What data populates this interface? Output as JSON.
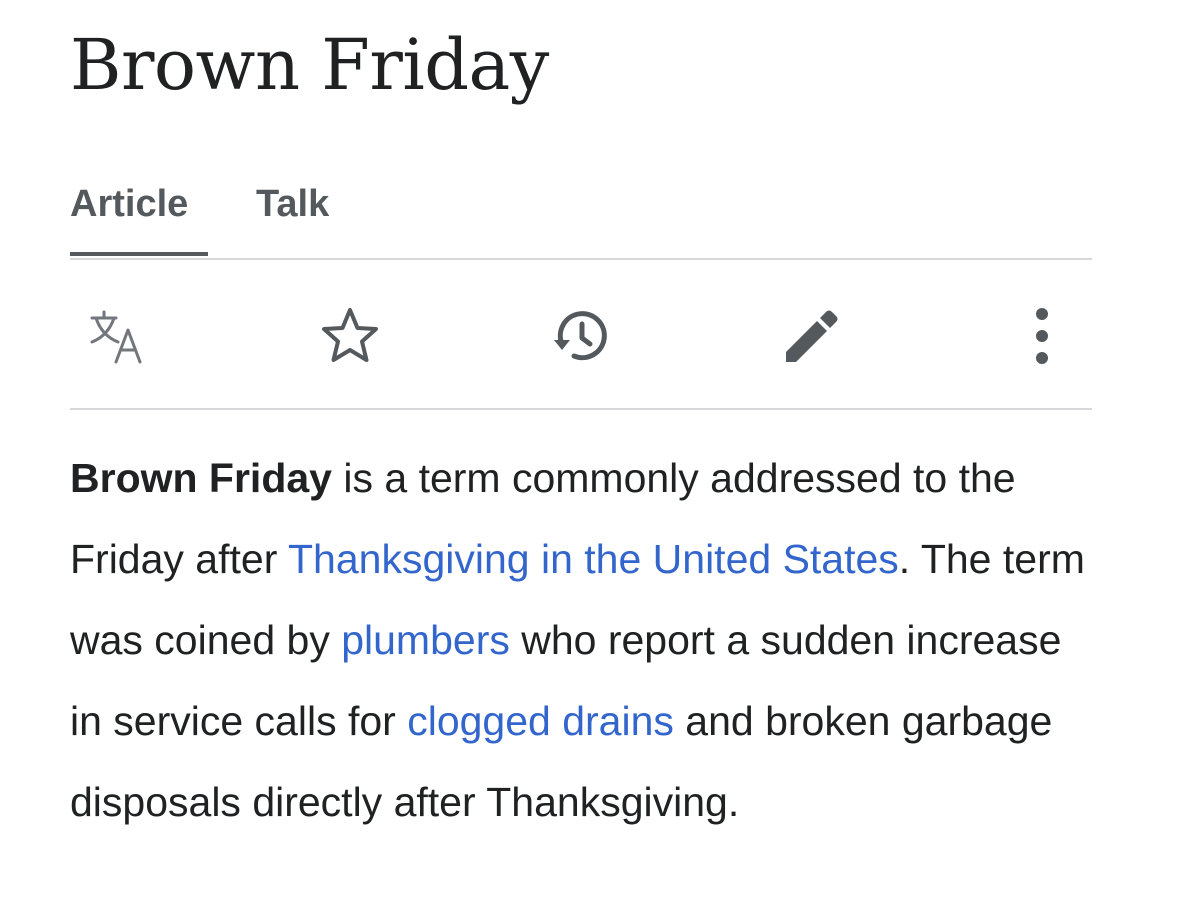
{
  "page": {
    "title": "Brown Friday"
  },
  "tabs": [
    {
      "label": "Article",
      "active": true
    },
    {
      "label": "Talk",
      "active": false
    }
  ],
  "toolbar": {
    "icons": [
      "language-icon",
      "star-icon",
      "history-icon",
      "pencil-icon",
      "more-vertical-icon"
    ]
  },
  "article": {
    "subject": "Brown Friday",
    "text_1": " is a term commonly addressed to the Friday after ",
    "link_1": "Thanksgiving in the United States",
    "text_2": ". The term was coined by ",
    "link_2": "plumbers",
    "text_3": " who report a sudden increase in service calls for ",
    "link_3": "clogged drains",
    "text_4": " and broken garbage disposals directly after Thanksgiving."
  },
  "colors": {
    "text": "#202122",
    "link": "#3366cc",
    "tab": "#54595d",
    "divider": "#d7d8da",
    "icon": "#54595d",
    "icon_light": "#72777d"
  }
}
